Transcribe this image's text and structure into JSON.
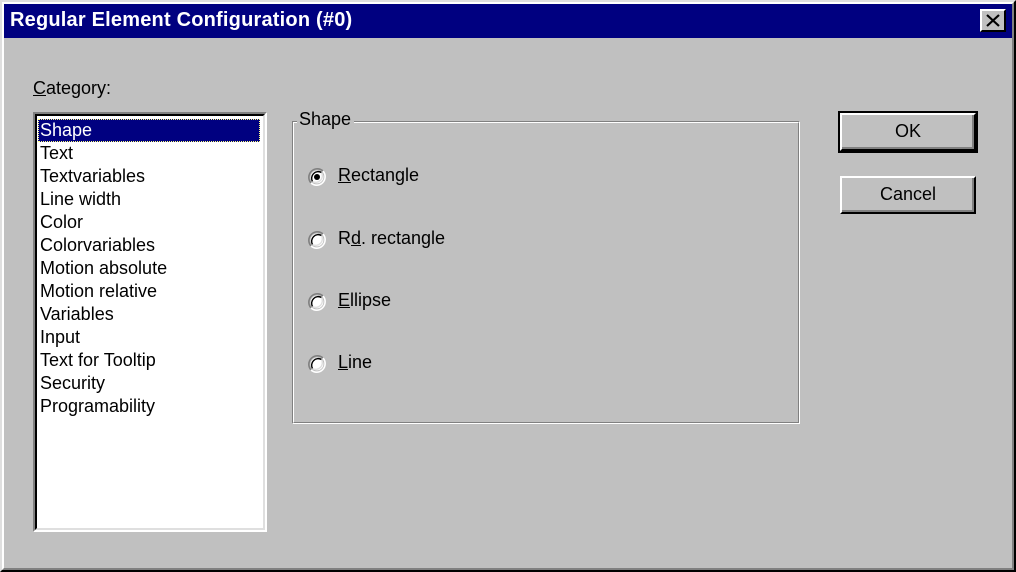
{
  "window": {
    "title": "Regular Element Configuration (#0)"
  },
  "category": {
    "label_prefix": "",
    "label_accel": "C",
    "label_rest": "ategory:",
    "items": [
      {
        "label": "Shape",
        "selected": true
      },
      {
        "label": "Text",
        "selected": false
      },
      {
        "label": "Textvariables",
        "selected": false
      },
      {
        "label": "Line width",
        "selected": false
      },
      {
        "label": "Color",
        "selected": false
      },
      {
        "label": "Colorvariables",
        "selected": false
      },
      {
        "label": "Motion absolute",
        "selected": false
      },
      {
        "label": "Motion relative",
        "selected": false
      },
      {
        "label": "Variables",
        "selected": false
      },
      {
        "label": "Input",
        "selected": false
      },
      {
        "label": "Text for Tooltip",
        "selected": false
      },
      {
        "label": "Security",
        "selected": false
      },
      {
        "label": "Programability",
        "selected": false
      }
    ]
  },
  "shape_group": {
    "legend": "Shape",
    "options": [
      {
        "pre": "",
        "accel": "R",
        "post": "ectangle",
        "checked": true
      },
      {
        "pre": "R",
        "accel": "d",
        "post": ". rectangle",
        "checked": false
      },
      {
        "pre": "",
        "accel": "E",
        "post": "llipse",
        "checked": false
      },
      {
        "pre": "",
        "accel": "L",
        "post": "ine",
        "checked": false
      }
    ]
  },
  "buttons": {
    "ok_label": "OK",
    "cancel_label": "Cancel"
  },
  "colors": {
    "titlebar": "#000080",
    "dialog_bg": "#c0c0c0",
    "selection": "#000080"
  }
}
